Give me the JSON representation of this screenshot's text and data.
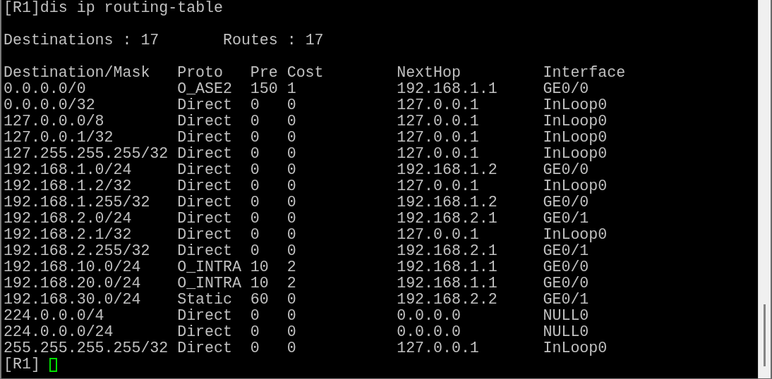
{
  "terminal": {
    "command": "[R1]dis ip routing-table",
    "summary": [
      "Destinations : 17",
      "Routes : 17"
    ],
    "columns": [
      "Destination/Mask",
      "Proto",
      "Pre",
      "Cost",
      "NextHop",
      "Interface"
    ],
    "rows": [
      [
        "0.0.0.0/0",
        "O_ASE2",
        "150",
        "1",
        "192.168.1.1",
        "GE0/0"
      ],
      [
        "0.0.0.0/32",
        "Direct",
        "0",
        "0",
        "127.0.0.1",
        "InLoop0"
      ],
      [
        "127.0.0.0/8",
        "Direct",
        "0",
        "0",
        "127.0.0.1",
        "InLoop0"
      ],
      [
        "127.0.0.1/32",
        "Direct",
        "0",
        "0",
        "127.0.0.1",
        "InLoop0"
      ],
      [
        "127.255.255.255/32",
        "Direct",
        "0",
        "0",
        "127.0.0.1",
        "InLoop0"
      ],
      [
        "192.168.1.0/24",
        "Direct",
        "0",
        "0",
        "192.168.1.2",
        "GE0/0"
      ],
      [
        "192.168.1.2/32",
        "Direct",
        "0",
        "0",
        "127.0.0.1",
        "InLoop0"
      ],
      [
        "192.168.1.255/32",
        "Direct",
        "0",
        "0",
        "192.168.1.2",
        "GE0/0"
      ],
      [
        "192.168.2.0/24",
        "Direct",
        "0",
        "0",
        "192.168.2.1",
        "GE0/1"
      ],
      [
        "192.168.2.1/32",
        "Direct",
        "0",
        "0",
        "127.0.0.1",
        "InLoop0"
      ],
      [
        "192.168.2.255/32",
        "Direct",
        "0",
        "0",
        "192.168.2.1",
        "GE0/1"
      ],
      [
        "192.168.10.0/24",
        "O_INTRA",
        "10",
        "2",
        "192.168.1.1",
        "GE0/0"
      ],
      [
        "192.168.20.0/24",
        "O_INTRA",
        "10",
        "2",
        "192.168.1.1",
        "GE0/0"
      ],
      [
        "192.168.30.0/24",
        "Static",
        "60",
        "0",
        "192.168.2.2",
        "GE0/1"
      ],
      [
        "224.0.0.0/4",
        "Direct",
        "0",
        "0",
        "0.0.0.0",
        "NULL0"
      ],
      [
        "224.0.0.0/24",
        "Direct",
        "0",
        "0",
        "0.0.0.0",
        "NULL0"
      ],
      [
        "255.255.255.255/32",
        "Direct",
        "0",
        "0",
        "127.0.0.1",
        "InLoop0"
      ]
    ],
    "prompt": "[R1]"
  }
}
